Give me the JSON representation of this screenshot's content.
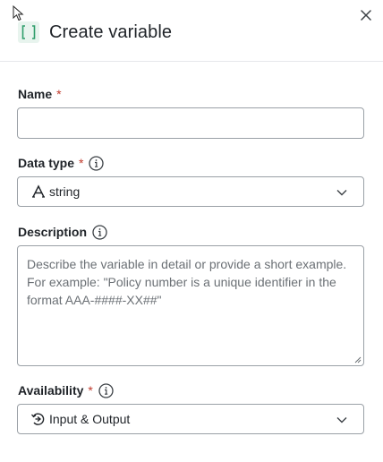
{
  "header": {
    "title": "Create variable",
    "icon": "brackets-icon",
    "close_icon": "close-icon"
  },
  "fields": {
    "name": {
      "label": "Name",
      "required_mark": "*",
      "value": ""
    },
    "data_type": {
      "label": "Data type",
      "required_mark": "*",
      "info_icon": "info-icon",
      "selected": "string",
      "selected_icon": "text-type-icon"
    },
    "description": {
      "label": "Description",
      "info_icon": "info-icon",
      "value": "",
      "placeholder": "Describe the variable in detail or provide a short example. For example: \"Policy number is a unique identifier in the format AAA-####-XX##\""
    },
    "availability": {
      "label": "Availability",
      "required_mark": "*",
      "info_icon": "info-icon",
      "selected": "Input & Output",
      "selected_icon": "input-output-icon"
    }
  },
  "colors": {
    "accent": "#2e9d6a",
    "accent_bg": "#e8f4ee",
    "required": "#c0392b",
    "border": "#9aa0a6",
    "placeholder": "#6b7075"
  }
}
